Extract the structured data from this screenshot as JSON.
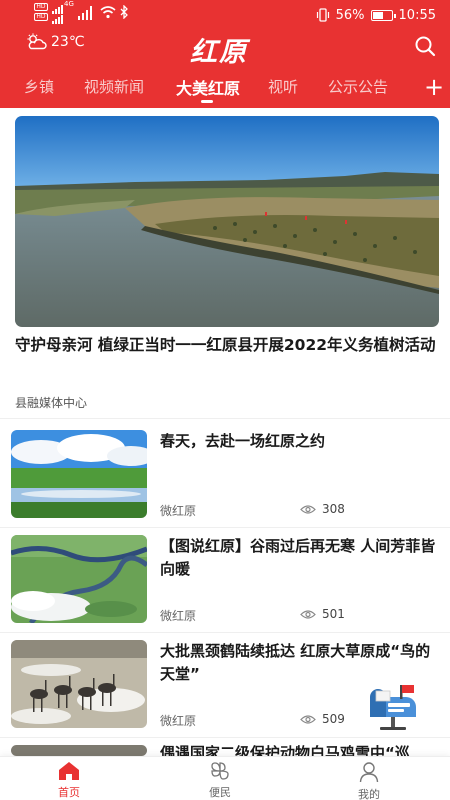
{
  "status_bar": {
    "network": "4G",
    "battery": "56%",
    "battery_level": 0.56,
    "time": "10:55"
  },
  "header": {
    "weather_icon": "partly-cloudy-icon",
    "temperature": "23℃",
    "logo_text": "红原",
    "search_icon": "search-icon"
  },
  "tabs": [
    {
      "label": "乡镇",
      "active": false
    },
    {
      "label": "视频新闻",
      "active": false
    },
    {
      "label": "大美红原",
      "active": true
    },
    {
      "label": "视听",
      "active": false
    },
    {
      "label": "公示公告",
      "active": false
    }
  ],
  "tab_more": "+",
  "hero": {
    "title": "守护母亲河 植绿正当时一一红原县开展2022年义务植树活动",
    "source": "县融媒体中心"
  },
  "articles": [
    {
      "title": "春天，去赴一场红原之约",
      "source": "微红原",
      "views": "308"
    },
    {
      "title": "【图说红原】谷雨过后再无寒 人间芳菲皆向暖",
      "source": "微红原",
      "views": "501"
    },
    {
      "title": "大批黑颈鹤陆续抵达 红原大草原成“鸟的天堂”",
      "source": "微红原",
      "views": "509"
    },
    {
      "title": "偶遇国家二级保护动物白马鸡雪中“巡",
      "source": "",
      "views": ""
    }
  ],
  "bottom_nav": [
    {
      "label": "首页",
      "icon": "home-icon",
      "active": true
    },
    {
      "label": "便民",
      "icon": "services-icon",
      "active": false
    },
    {
      "label": "我的",
      "icon": "profile-icon",
      "active": false
    }
  ],
  "colors": {
    "brand_red": "#e83232",
    "text_dark": "#1a1a1a",
    "text_muted": "#666666"
  }
}
